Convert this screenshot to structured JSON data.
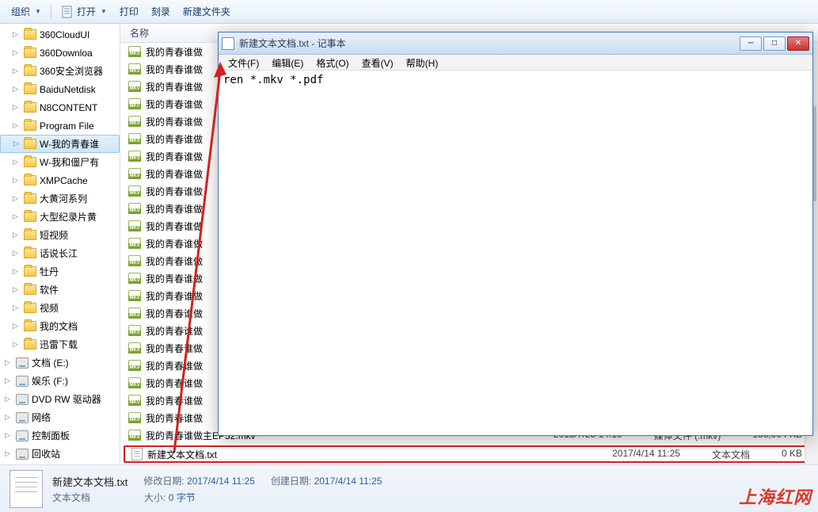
{
  "toolbar": {
    "organize": "组织",
    "open": "打开",
    "print": "打印",
    "burn": "刻录",
    "newfolder": "新建文件夹"
  },
  "tree": {
    "items": [
      {
        "label": "360CloudUI",
        "type": "folder"
      },
      {
        "label": "360Downloa",
        "type": "folder"
      },
      {
        "label": "360安全浏览器",
        "type": "folder"
      },
      {
        "label": "BaiduNetdisk",
        "type": "folder"
      },
      {
        "label": "N8CONTENT",
        "type": "folder"
      },
      {
        "label": "Program File",
        "type": "folder"
      },
      {
        "label": "W-我的青春谁",
        "type": "folder",
        "selected": true
      },
      {
        "label": "W-我和僵尸有",
        "type": "folder"
      },
      {
        "label": "XMPCache",
        "type": "folder"
      },
      {
        "label": "大黄河系列",
        "type": "folder"
      },
      {
        "label": "大型纪录片黄",
        "type": "folder"
      },
      {
        "label": "短视频",
        "type": "folder"
      },
      {
        "label": "话说长江",
        "type": "folder"
      },
      {
        "label": "牡丹",
        "type": "folder"
      },
      {
        "label": "软件",
        "type": "folder"
      },
      {
        "label": "视频",
        "type": "folder"
      },
      {
        "label": "我的文档",
        "type": "folder"
      },
      {
        "label": "迅雷下载",
        "type": "folder"
      },
      {
        "label": "文档 (E:)",
        "type": "device"
      },
      {
        "label": "娱乐 (F:)",
        "type": "device"
      },
      {
        "label": "DVD RW 驱动器",
        "type": "device"
      },
      {
        "label": "网络",
        "type": "device"
      },
      {
        "label": "控制面板",
        "type": "device"
      },
      {
        "label": "回收站",
        "type": "device"
      }
    ]
  },
  "filelist": {
    "header": "名称",
    "files": [
      "我的青春谁做",
      "我的青春谁做",
      "我的青春谁做",
      "我的青春谁做",
      "我的青春谁做",
      "我的青春谁做",
      "我的青春谁做",
      "我的青春谁做",
      "我的青春谁做",
      "我的青春谁做",
      "我的青春谁做",
      "我的青春谁做",
      "我的青春谁做",
      "我的青春谁做",
      "我的青春谁做",
      "我的青春谁做",
      "我的青春谁做",
      "我的青春谁做",
      "我的青春谁做",
      "我的青春谁做",
      "我的青春谁做",
      "我的青春谁做",
      "我的青春谁做主EP32.mkv"
    ],
    "txt_file": "新建文本文档.txt",
    "meta_date1": "2013/7/25 14:10",
    "meta_type1": "媒体文件 (.mkv)",
    "meta_size1": "156,904 KB",
    "meta_date2": "2017/4/14 11:25",
    "meta_type2": "文本文档",
    "meta_size2": "0 KB"
  },
  "details": {
    "filename": "新建文本文档.txt",
    "filetype": "文本文档",
    "mod_label": "修改日期:",
    "mod_value": "2017/4/14 11:25",
    "create_label": "创建日期:",
    "create_value": "2017/4/14 11:25",
    "size_label": "大小:",
    "size_value": "0 字节"
  },
  "notepad": {
    "title": "新建文本文档.txt - 记事本",
    "menu": {
      "file": "文件(F)",
      "edit": "编辑(E)",
      "format": "格式(O)",
      "view": "查看(V)",
      "help": "帮助(H)"
    },
    "content": "ren *.mkv *.pdf"
  },
  "watermark": "上海红网"
}
